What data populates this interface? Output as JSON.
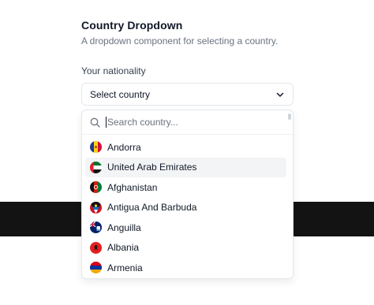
{
  "header": {
    "title": "Country Dropdown",
    "subtitle": "A dropdown component for selecting a country."
  },
  "field": {
    "label": "Your nationality",
    "selected": "Select country"
  },
  "search": {
    "placeholder": "Search country..."
  },
  "countries": [
    {
      "label": "Andorra",
      "icon": "andorra-flag-icon"
    },
    {
      "label": "United Arab Emirates",
      "icon": "uae-flag-icon",
      "highlighted": true
    },
    {
      "label": "Afghanistan",
      "icon": "afghanistan-flag-icon"
    },
    {
      "label": "Antigua And Barbuda",
      "icon": "antigua-flag-icon"
    },
    {
      "label": "Anguilla",
      "icon": "anguilla-flag-icon"
    },
    {
      "label": "Albania",
      "icon": "albania-flag-icon"
    },
    {
      "label": "Armenia",
      "icon": "armenia-flag-icon"
    }
  ],
  "colors": {
    "band": "#131313",
    "highlight": "#f3f4f6",
    "border": "#e5e7eb"
  }
}
